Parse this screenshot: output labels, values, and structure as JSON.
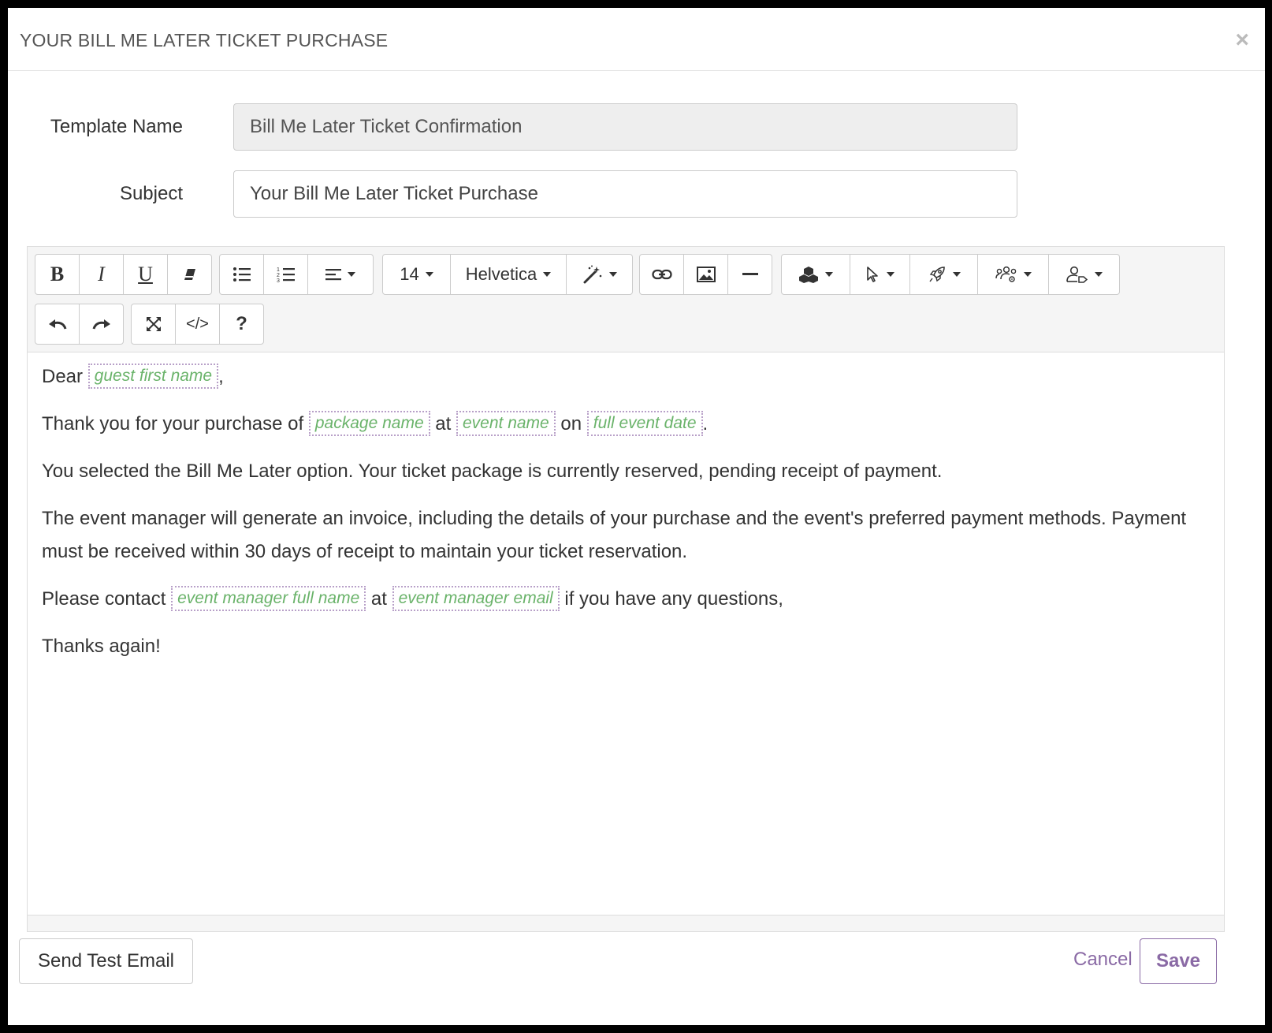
{
  "modal": {
    "title": "YOUR BILL ME LATER TICKET PURCHASE",
    "close_label": "×"
  },
  "form": {
    "template_name_label": "Template Name",
    "template_name_value": "Bill Me Later Ticket Confirmation",
    "subject_label": "Subject",
    "subject_value": "Your Bill Me Later Ticket Purchase"
  },
  "toolbar": {
    "bold": "B",
    "italic": "I",
    "underline": "U",
    "font_size": "14",
    "font_family": "Helvetica",
    "help": "?",
    "code": "</>"
  },
  "body": {
    "p1_start": "Dear",
    "p1_tag": "guest first name",
    "p1_end": ",",
    "p2_start": "Thank you for your purchase of",
    "p2_tag1": "package name",
    "p2_mid1": "at",
    "p2_tag2": "event name",
    "p2_mid2": "on",
    "p2_tag3": "full event date",
    "p2_end": ".",
    "p3": "You selected the Bill Me Later option. Your ticket package is currently reserved, pending receipt of payment.",
    "p4": "The event manager will generate an invoice, including the details of your purchase and the event's preferred payment methods. Payment must be received within 30 days of receipt to maintain your ticket reservation.",
    "p5_start": "Please contact",
    "p5_tag1": "event manager full name",
    "p5_mid": "at",
    "p5_tag2": "event manager email",
    "p5_end": "if you have any questions,",
    "p6": "Thanks again!"
  },
  "footer": {
    "send_test_label": "Send Test Email",
    "cancel_label": "Cancel",
    "save_label": "Save"
  },
  "colors": {
    "accent": "#8a6aa5",
    "tag_text": "#6ab36a",
    "tag_border": "#b8a0c8"
  }
}
